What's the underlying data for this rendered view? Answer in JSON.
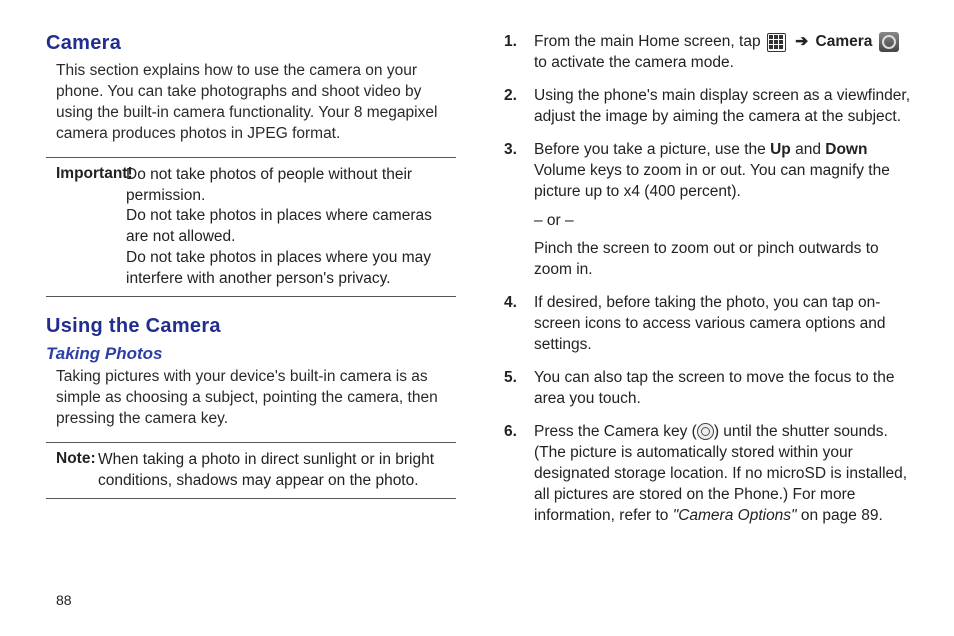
{
  "left": {
    "heading_camera": "Camera",
    "intro": "This section explains how to use the camera on your phone. You can take photographs and shoot video by using the built-in camera functionality. Your 8 megapixel camera produces photos in JPEG format.",
    "important_label": "Important!",
    "important_l1": "Do not take photos of people without their permission.",
    "important_l2": "Do not take photos in places where cameras are not allowed.",
    "important_l3": "Do not take photos in places where you may interfere with another person's privacy.",
    "heading_using": "Using the Camera",
    "subhead_taking": "Taking Photos",
    "taking_intro": "Taking pictures with your device's built-in camera is as simple as choosing a subject, pointing the camera, then pressing the camera key.",
    "note_label": "Note:",
    "note_text": "When taking a photo in direct sunlight or in bright conditions, shadows may appear on the photo."
  },
  "right": {
    "step1_a": "From the main Home screen, tap ",
    "step1_arrow": "➔",
    "step1_camera_word": "Camera",
    "step1_b": " to activate the camera mode.",
    "step2": "Using the phone's main display screen as a viewfinder, adjust the image by aiming the camera at the subject.",
    "step3_a": "Before you take a picture, use the ",
    "step3_up": "Up",
    "step3_mid": " and ",
    "step3_down": "Down",
    "step3_b": " Volume keys to zoom in or out. You can magnify the picture up to x4 (400 percent).",
    "step3_or": "– or –",
    "step3_pinch": "Pinch the screen to zoom out or pinch outwards to zoom in.",
    "step4": "If desired, before taking the photo, you can tap on-screen icons to access various camera options and settings.",
    "step5": "You can also tap the screen to move the focus to the area you touch.",
    "step6_a": "Press the Camera key (",
    "step6_b": ") until the shutter sounds. (The picture is automatically stored within your designated storage location. If no microSD is installed, all pictures are stored on the Phone.) For more information, refer to ",
    "step6_ref": "\"Camera Options\"",
    "step6_c": "  on page 89."
  },
  "page_num": "88"
}
